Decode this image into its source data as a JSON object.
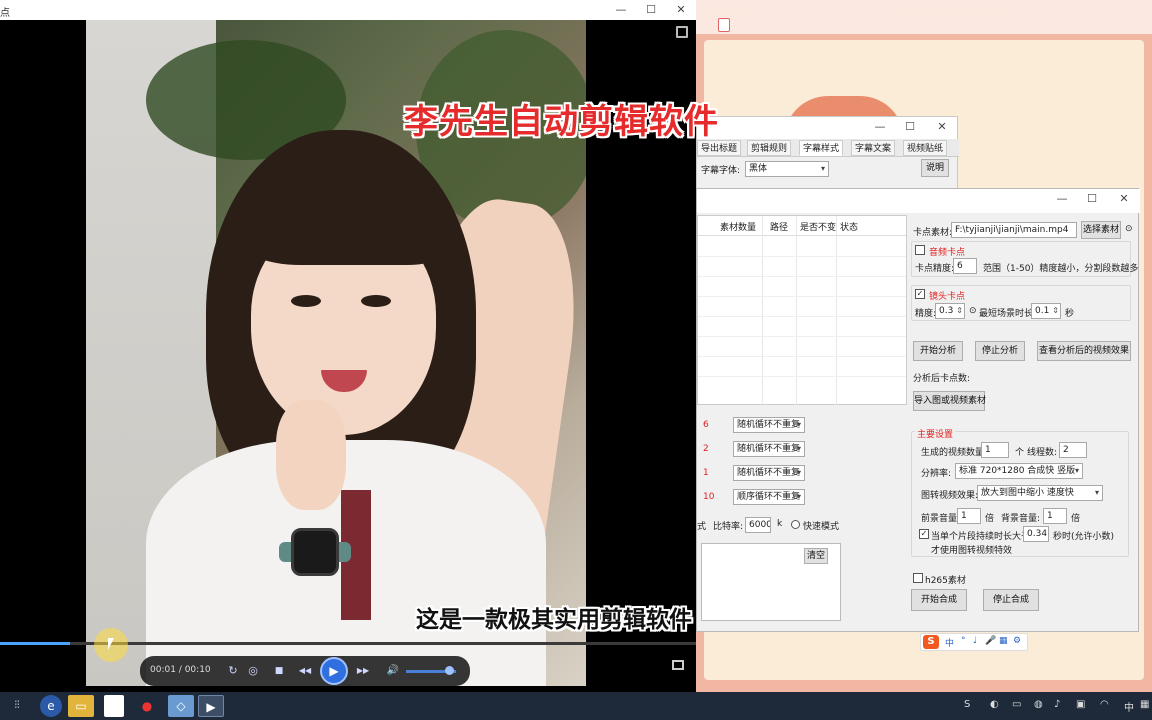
{
  "player": {
    "title_fragment": "点",
    "overlay_title": "李先生自动剪辑软件",
    "overlay_caption": "这是一款极其实用剪辑软件",
    "current_time": "00:01",
    "separator": " / ",
    "total_time": "00:10",
    "progress": 0.1,
    "controls": {
      "minimize": "—",
      "maximize": "☐",
      "close": "✕",
      "prev": "◀◀",
      "play": "▶",
      "next": "▶▶",
      "stop": "■",
      "volume_icon": "🔊"
    }
  },
  "back_window": {
    "tabs": [
      "导出标题",
      "剪辑规则",
      "字幕样式",
      "字幕文案",
      "视频贴纸"
    ],
    "active_tab": 2,
    "font_label": "字幕字体:",
    "font_value": "黑体",
    "help_button": "说明"
  },
  "main_window": {
    "grid_headers": [
      "素材数量",
      "路径",
      "是否不变",
      "状态"
    ],
    "modes": [
      {
        "num": "6",
        "value": "随机循环不重复"
      },
      {
        "num": "2",
        "value": "随机循环不重复"
      },
      {
        "num": "1",
        "value": "随机循环不重复"
      },
      {
        "num": "10",
        "value": "顺序循环不重复"
      }
    ],
    "mode_suffix": "式",
    "bitrate_label": "比特率:",
    "bitrate_value": "6000",
    "bitrate_unit": "k",
    "fast_mode": "快速模式",
    "clear_button": "清空",
    "cut_source_label": "卡点素材:",
    "cut_source_value": "F:\\tyjianji\\jianji\\main.mp4",
    "select_source_button": "选择素材",
    "audio_cut_label": "音频卡点",
    "audio_precision_label": "卡点精度:",
    "audio_precision_value": "6",
    "audio_range_text": "范围（1-50）精度越小，分割段数越多",
    "shot_cut_label": "镜头卡点",
    "shot_precision_label": "精度:",
    "shot_precision_value": "0.3",
    "shortest_scene_label": "最短场景时长:",
    "shortest_scene_value": "0.1",
    "seconds_unit": "秒",
    "start_analysis": "开始分析",
    "stop_analysis": "停止分析",
    "view_analysis": "查看分析后的视频效果",
    "cut_count_label": "分析后卡点数:",
    "import_button": "导入图或视频素材",
    "main_settings": "主要设置",
    "video_count_label": "生成的视频数量:",
    "video_count_value": "1",
    "video_count_unit": "个",
    "threads_label": "线程数:",
    "threads_value": "2",
    "resolution_label": "分辨率:",
    "resolution_value": "标准 720*1280 合成快 竖版",
    "image_effect_label": "图转视频效果:",
    "image_effect_value": "放大到图中缩小 速度快",
    "fg_volume_label": "前景音量:",
    "fg_volume_value": "1",
    "times_unit": "倍",
    "bg_volume_label": "背景音量:",
    "bg_volume_value": "1",
    "single_longer_label": "当单个片段持续时长大于",
    "single_longer_value": "0.34",
    "single_longer_suffix": "秒时(允许小数)",
    "image_effect_note": "才使用图转视频特效",
    "h265_label": "h265素材",
    "start_compose": "开始合成",
    "stop_compose": "停止合成"
  },
  "ime": {
    "items": [
      "中",
      "°",
      "♩",
      "🎤",
      "▦",
      "⚙"
    ]
  },
  "taskbar": {
    "tray_lang": "中"
  }
}
